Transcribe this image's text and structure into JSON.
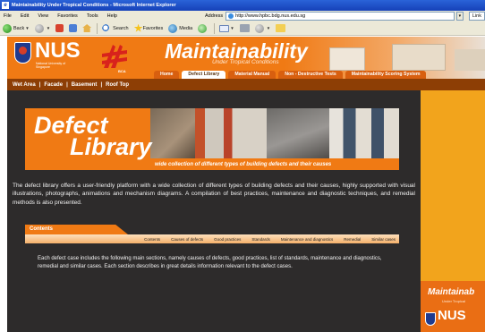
{
  "window": {
    "title": "Maintainability Under Tropical Conditions - Microsoft Internet Explorer"
  },
  "menu": [
    "File",
    "Edit",
    "View",
    "Favorites",
    "Tools",
    "Help"
  ],
  "address": {
    "label": "Address",
    "url": "http://www.hpbc.bdg.nus.edu.sg",
    "links_label": "Link"
  },
  "toolbar": {
    "back_label": "Back",
    "search_label": "Search",
    "favorites_label": "Favorites",
    "media_label": "Media"
  },
  "header": {
    "nus_logo_text": "NUS",
    "nus_subtitle": "National University of Singapore",
    "bca_label": "BCA",
    "site_title": "Maintainability",
    "site_subtitle": "Under Tropical Conditions"
  },
  "nav_tabs": [
    {
      "label": "Home"
    },
    {
      "label": "Defect Library",
      "active": true
    },
    {
      "label": "Material Manual"
    },
    {
      "label": "Non - Destructive Tests"
    },
    {
      "label": "Maintainability Scoring System"
    }
  ],
  "sub_nav": [
    "Wet Area",
    "Facade",
    "Basement",
    "Roof Top"
  ],
  "banner": {
    "title_line1": "Defect",
    "title_line2": "Library",
    "tagline": "wide collection of different types of building defects and their causes"
  },
  "intro_text": "The defect library offers a user-friendly platform with a wide collection of different types of building defects and their causes, highly supported with visual illustrations, photographs, animations and mechanism diagrams. A compilation of best practices, maintenance and diagnostic techniques, and remedial methods is also presented.",
  "contents": {
    "heading": "Contents",
    "links": [
      "Contents",
      "Causes of defects",
      "Good practices",
      "Standards",
      "Maintenance and diagnostics",
      "Remedial",
      "Similar cases"
    ],
    "description": "Each defect case includes the following main sections, namely causes of defects, good practices, list of standards, maintenance and diagnostics, remedial and similar cases. Each section describes in great details information relevant to the defect cases."
  },
  "right_rail": {
    "title": "Maintainab",
    "subtitle": "Under Tropical",
    "nus_text": "NUS"
  },
  "colors": {
    "accent_orange": "#f07a14",
    "dark_panel": "#2d2b2b",
    "sub_nav_brown": "#8d3e05",
    "rail_yellow": "#f2a41c"
  }
}
